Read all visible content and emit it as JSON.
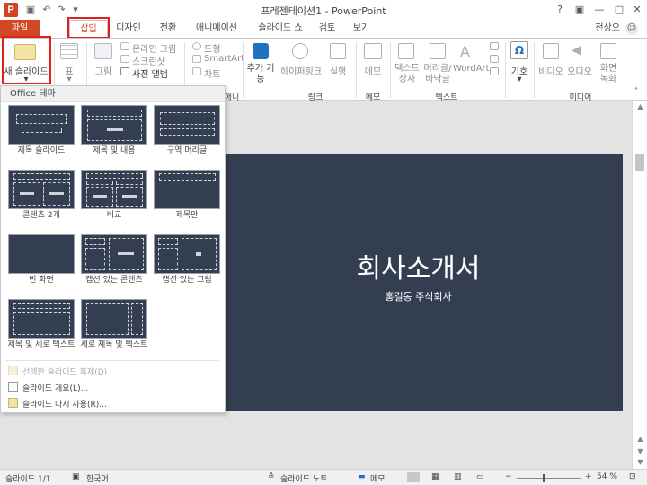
{
  "window": {
    "title": "프레젠테이션1 - PowerPoint",
    "app_icon": "P",
    "buttons": [
      "?",
      "▣",
      "—",
      "□",
      "✕"
    ]
  },
  "tabs": [
    "파일",
    "삽입",
    "디자인",
    "전환",
    "애니메이션",
    "슬라이드 쇼",
    "검토",
    "보기"
  ],
  "active_tab": "삽입",
  "user": "전상오",
  "ribbon": {
    "new_slide": "새 슬라이드",
    "table": "표",
    "picture": "그림",
    "online_picture": "온라인 그림",
    "screenshot": "스크린샷",
    "photo_album": "사진 앨범",
    "shapes": "도형",
    "smartart": "SmartArt",
    "chart": "차트",
    "addins": "추가 기능",
    "hyperlink": "하이퍼링크",
    "action": "실행",
    "comment": "메모",
    "textbox": "텍스트 상자",
    "header_footer": "머리글/ 바닥글",
    "wordart": "WordArt",
    "symbol": "기호",
    "video": "비디오",
    "audio": "오디오",
    "screen_recording": "화면 녹화",
    "group_animation": "애니메이션",
    "group_links": "링크",
    "group_comments": "메모",
    "group_text": "텍스트",
    "group_media": "미디어"
  },
  "dropdown": {
    "header": "Office 테마",
    "layouts": [
      "제목 슬라이드",
      "제목 및 내용",
      "구역 머리글",
      "콘텐츠 2개",
      "비교",
      "제목만",
      "빈 화면",
      "캡션 있는 콘텐츠",
      "캡션 있는 그림",
      "제목 및 세로 텍스트",
      "세로 제목 및 텍스트"
    ],
    "commands": [
      "선택한 슬라이드 복제(D)",
      "슬라이드 개요(L)...",
      "슬라이드 다시 사용(R)..."
    ]
  },
  "slide": {
    "title": "회사소개서",
    "subtitle": "홍길동 주식회사",
    "background": "#333e50"
  },
  "status": {
    "slide_info": "슬라이드 1/1",
    "language": "한국어",
    "notes": "슬라이드 노트",
    "comments": "메모",
    "zoom": "54 %"
  },
  "colors": {
    "accent": "#d24726",
    "highlight": "#e02020"
  }
}
